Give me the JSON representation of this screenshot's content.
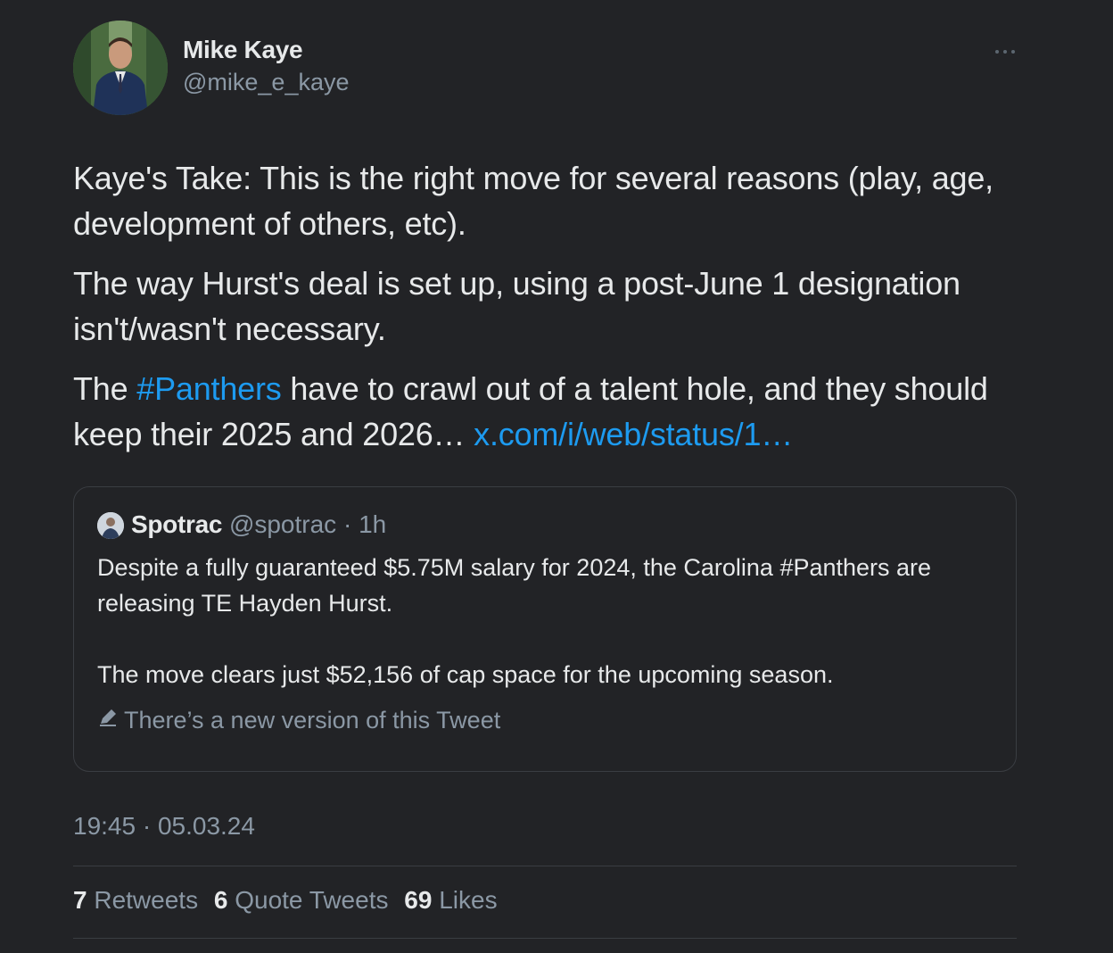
{
  "author": {
    "name": "Mike Kaye",
    "handle": "@mike_e_kaye"
  },
  "menu": {
    "icon": "more-horizontal-icon"
  },
  "body": {
    "p1": "Kaye's Take: This is the right move for several reasons (play, age, development of others, etc).",
    "p2": "The way Hurst's deal is set up, using a post-June 1 designation isn't/wasn't necessary.",
    "p3_before": "The ",
    "p3_hashtag": "#Panthers",
    "p3_after": " have to crawl out of a talent hole, and they should keep their 2025 and 2026… ",
    "p3_link": "x.com/i/web/status/1…"
  },
  "quote": {
    "name": "Spotrac",
    "handle": "@spotrac",
    "separator": "·",
    "time": "1h",
    "p1": "Despite a fully guaranteed $5.75M salary for 2024, the Carolina #Panthers are releasing TE Hayden Hurst.",
    "p2": "The move clears just $52,156 of cap space for the upcoming season.",
    "new_version": "There’s a new version of this Tweet"
  },
  "timestamp": "19:45 · 05.03.24",
  "stats": {
    "retweets_count": "7",
    "retweets_label": "Retweets",
    "quotes_count": "6",
    "quotes_label": "Quote Tweets",
    "likes_count": "69",
    "likes_label": "Likes"
  },
  "colors": {
    "background": "#222326",
    "text": "#e7e9ea",
    "secondary": "#8b98a5",
    "link": "#1d9bf0",
    "border": "#3a3d42"
  }
}
